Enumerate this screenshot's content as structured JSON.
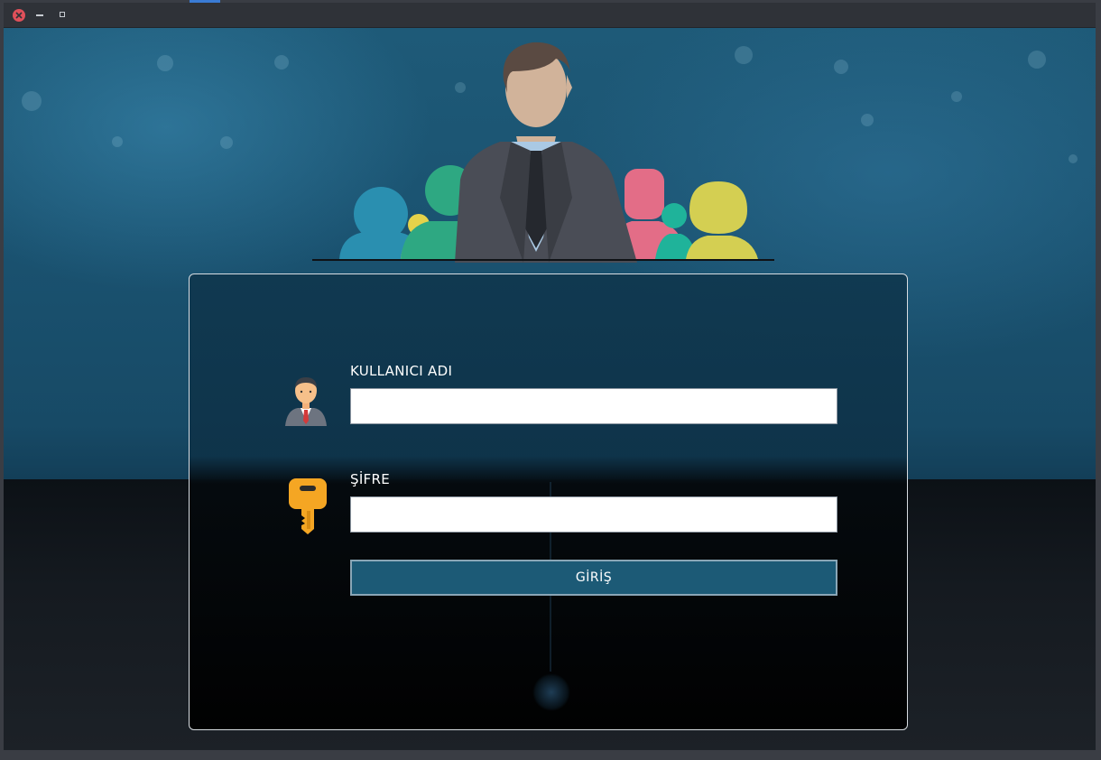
{
  "window": {
    "controls": [
      "close-icon",
      "minimize-icon",
      "maximize-icon"
    ]
  },
  "login": {
    "username_label": "KULLANICI ADI",
    "username_value": "",
    "password_label": "ŞİFRE",
    "password_value": "",
    "submit_label": "GİRİŞ"
  },
  "icons": {
    "user": "user-avatar-icon",
    "key": "key-icon",
    "hero": "team-illustration"
  },
  "colors": {
    "button": "#1c5a76",
    "close": "#e0505a",
    "key": "#f5a623"
  }
}
